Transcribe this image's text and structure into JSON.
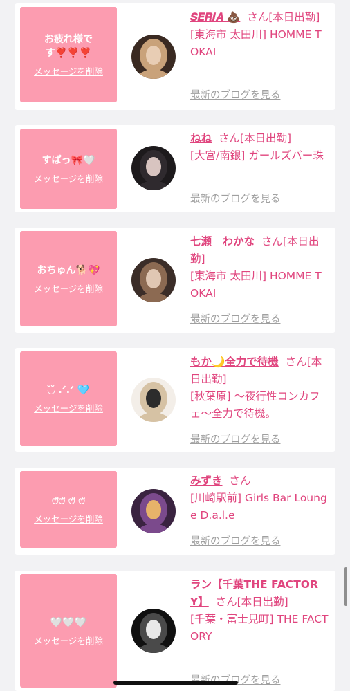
{
  "delete_label": "メッセージを削除",
  "blog_label": "最新のブログを見る",
  "accent_color": "#e0457e",
  "message_box_color": "#fc9cb0",
  "entries": [
    {
      "message": "お疲れ様です❣️❣️❣️",
      "name": "𝑺𝑬𝑹𝑰𝑨 💩",
      "suffix": "さん",
      "status": "[本日出勤]",
      "shop": "[東海市 太田川] HOMME TOKAI",
      "avatar_icon": "cast-avatar-photo"
    },
    {
      "message": "すぱっ🎀🤍",
      "name": "ねね",
      "suffix": "さん",
      "status": "[本日出勤]",
      "shop": "[大宮/南銀] ガールズバー珠",
      "avatar_icon": "cast-avatar-photo"
    },
    {
      "message": "おちゅん🐕💖",
      "name": "七瀬　わかな",
      "suffix": "さん",
      "status": "[本日出勤]",
      "shop": "[東海市 太田川] HOMME TOKAI",
      "avatar_icon": "cast-avatar-photo"
    },
    {
      "message": "◟̆◞̆ .ᐟ.ᐟ 🩵",
      "name": "もか🌙全力で待機",
      "suffix": "さん",
      "status": "[本日出勤]",
      "shop": "[秋葉原] 〜夜行性コンカフェ〜全力で待機。",
      "avatar_icon": "cast-avatar-photo"
    },
    {
      "message": "ෆ̈ෆ̈ ෆ̈ ෆ̈",
      "name": "みずき",
      "suffix": "さん",
      "status": "",
      "shop": "[川崎駅前] Girls Bar Lounge D.a.l.e",
      "avatar_icon": "cast-avatar-photo"
    },
    {
      "message": "🤍🤍🤍",
      "name": "ラン【千葉THE FACTORY】",
      "suffix": "さん",
      "status": "[本日出勤]",
      "shop": "[千葉・富士見町] THE FACTORY",
      "avatar_icon": "cast-avatar-photo"
    }
  ]
}
